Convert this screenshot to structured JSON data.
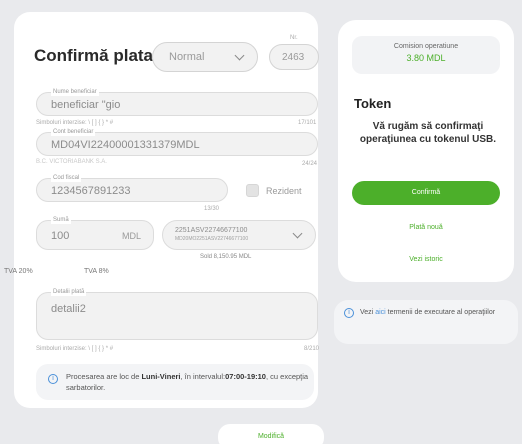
{
  "form": {
    "title": "Confirmă plata",
    "type_value": "Normal",
    "nr_label": "Nr.",
    "nr_value": "2463",
    "beneficiary_label": "Nume beneficiar",
    "beneficiary_value": "beneficiar \"gio",
    "beneficiary_hint": "Simboluri interzise: \\ [ ] { } * #",
    "beneficiary_counter": "17/101",
    "account_label": "Cont beneficiar",
    "account_value": "MD04VI22400001331379MDL",
    "account_bank": "B.C. VICTORIABANK S.A.",
    "account_counter": "24/24",
    "fiscal_label": "Cod fiscal",
    "fiscal_value": "1234567891233",
    "fiscal_counter": "13/30",
    "rezident_label": "Rezident",
    "amount_label": "Sumă",
    "amount_value": "100",
    "amount_currency": "MDL",
    "account_select_line1": "2251ASV22746677100",
    "account_select_line2": "MD20MO2251ASV22746677100",
    "balance": "Sold 8,150.95 MDL",
    "tva_20": "TVA 20%",
    "tva_8": "TVA 8%",
    "details_label": "Detalii plată",
    "details_value": "detalii2",
    "details_hint": "Simboluri interzise: \\ [ ] { } * #",
    "details_counter": "8/210",
    "info_prefix": "Procesarea are loc de ",
    "info_days": "Luni-Vineri",
    "info_mid": ", în intervalul:",
    "info_hours": "07:00-19:10",
    "info_suffix": ", cu excepţia sarbatorilor.",
    "modify_label": "Modifică"
  },
  "side": {
    "commission_label": "Comision operatiune",
    "commission_value": "3.80 MDL",
    "token_title": "Token",
    "token_text": "Vă rugăm să confirmaţi operaţiunea cu tokenul USB.",
    "confirm_label": "Confirmă",
    "new_payment_label": "Plată nouă",
    "history_label": "Vezi istoric",
    "terms_prefix": "Vezi ",
    "terms_link": "aici",
    "terms_suffix": " termenii de executare al operaţiilor"
  },
  "colors": {
    "accent_green": "#4caf2a",
    "info_blue": "#4a90d9",
    "background": "#e9eaed"
  }
}
